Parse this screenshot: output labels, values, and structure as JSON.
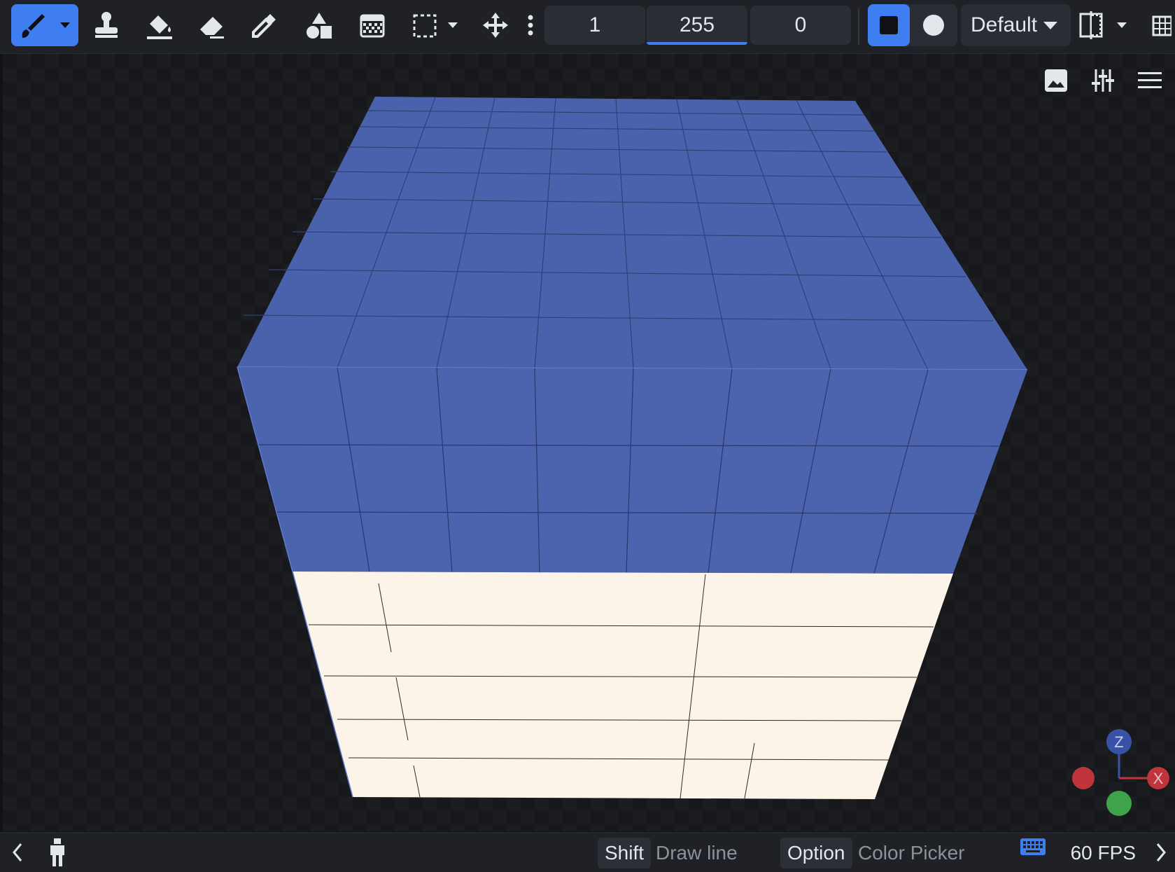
{
  "toolbar": {
    "tools": [
      {
        "name": "brush",
        "active": true
      },
      {
        "name": "stamp"
      },
      {
        "name": "fill"
      },
      {
        "name": "eraser"
      },
      {
        "name": "eyedropper"
      },
      {
        "name": "shapes"
      },
      {
        "name": "dither"
      },
      {
        "name": "selection"
      },
      {
        "name": "move"
      }
    ],
    "fields": [
      {
        "value": "1",
        "active": false
      },
      {
        "value": "255",
        "active": true
      },
      {
        "value": "0",
        "active": false
      }
    ],
    "brush_shapes": [
      "square",
      "circle"
    ],
    "brush_shape_selected": "square",
    "preset_dropdown": "Default"
  },
  "viewport": {
    "cube": {
      "top_color": "#4a62ab",
      "side_blue_color": "#4c63ad",
      "side_cream_color": "#fcf4e8"
    },
    "axes": {
      "z_label": "Z",
      "x_label": "X",
      "x_color": "#c0353c",
      "y_color": "#3fa34a",
      "z_color": "#3852a8"
    }
  },
  "statusbar": {
    "hints": [
      {
        "key": "Shift",
        "action": "Draw line"
      },
      {
        "key": "Option",
        "action": "Color Picker"
      }
    ],
    "fps": "60 FPS"
  },
  "colors": {
    "accent": "#3f7ef0",
    "toolbar_bg": "#1f2126",
    "viewport_bg": "#17181b"
  }
}
